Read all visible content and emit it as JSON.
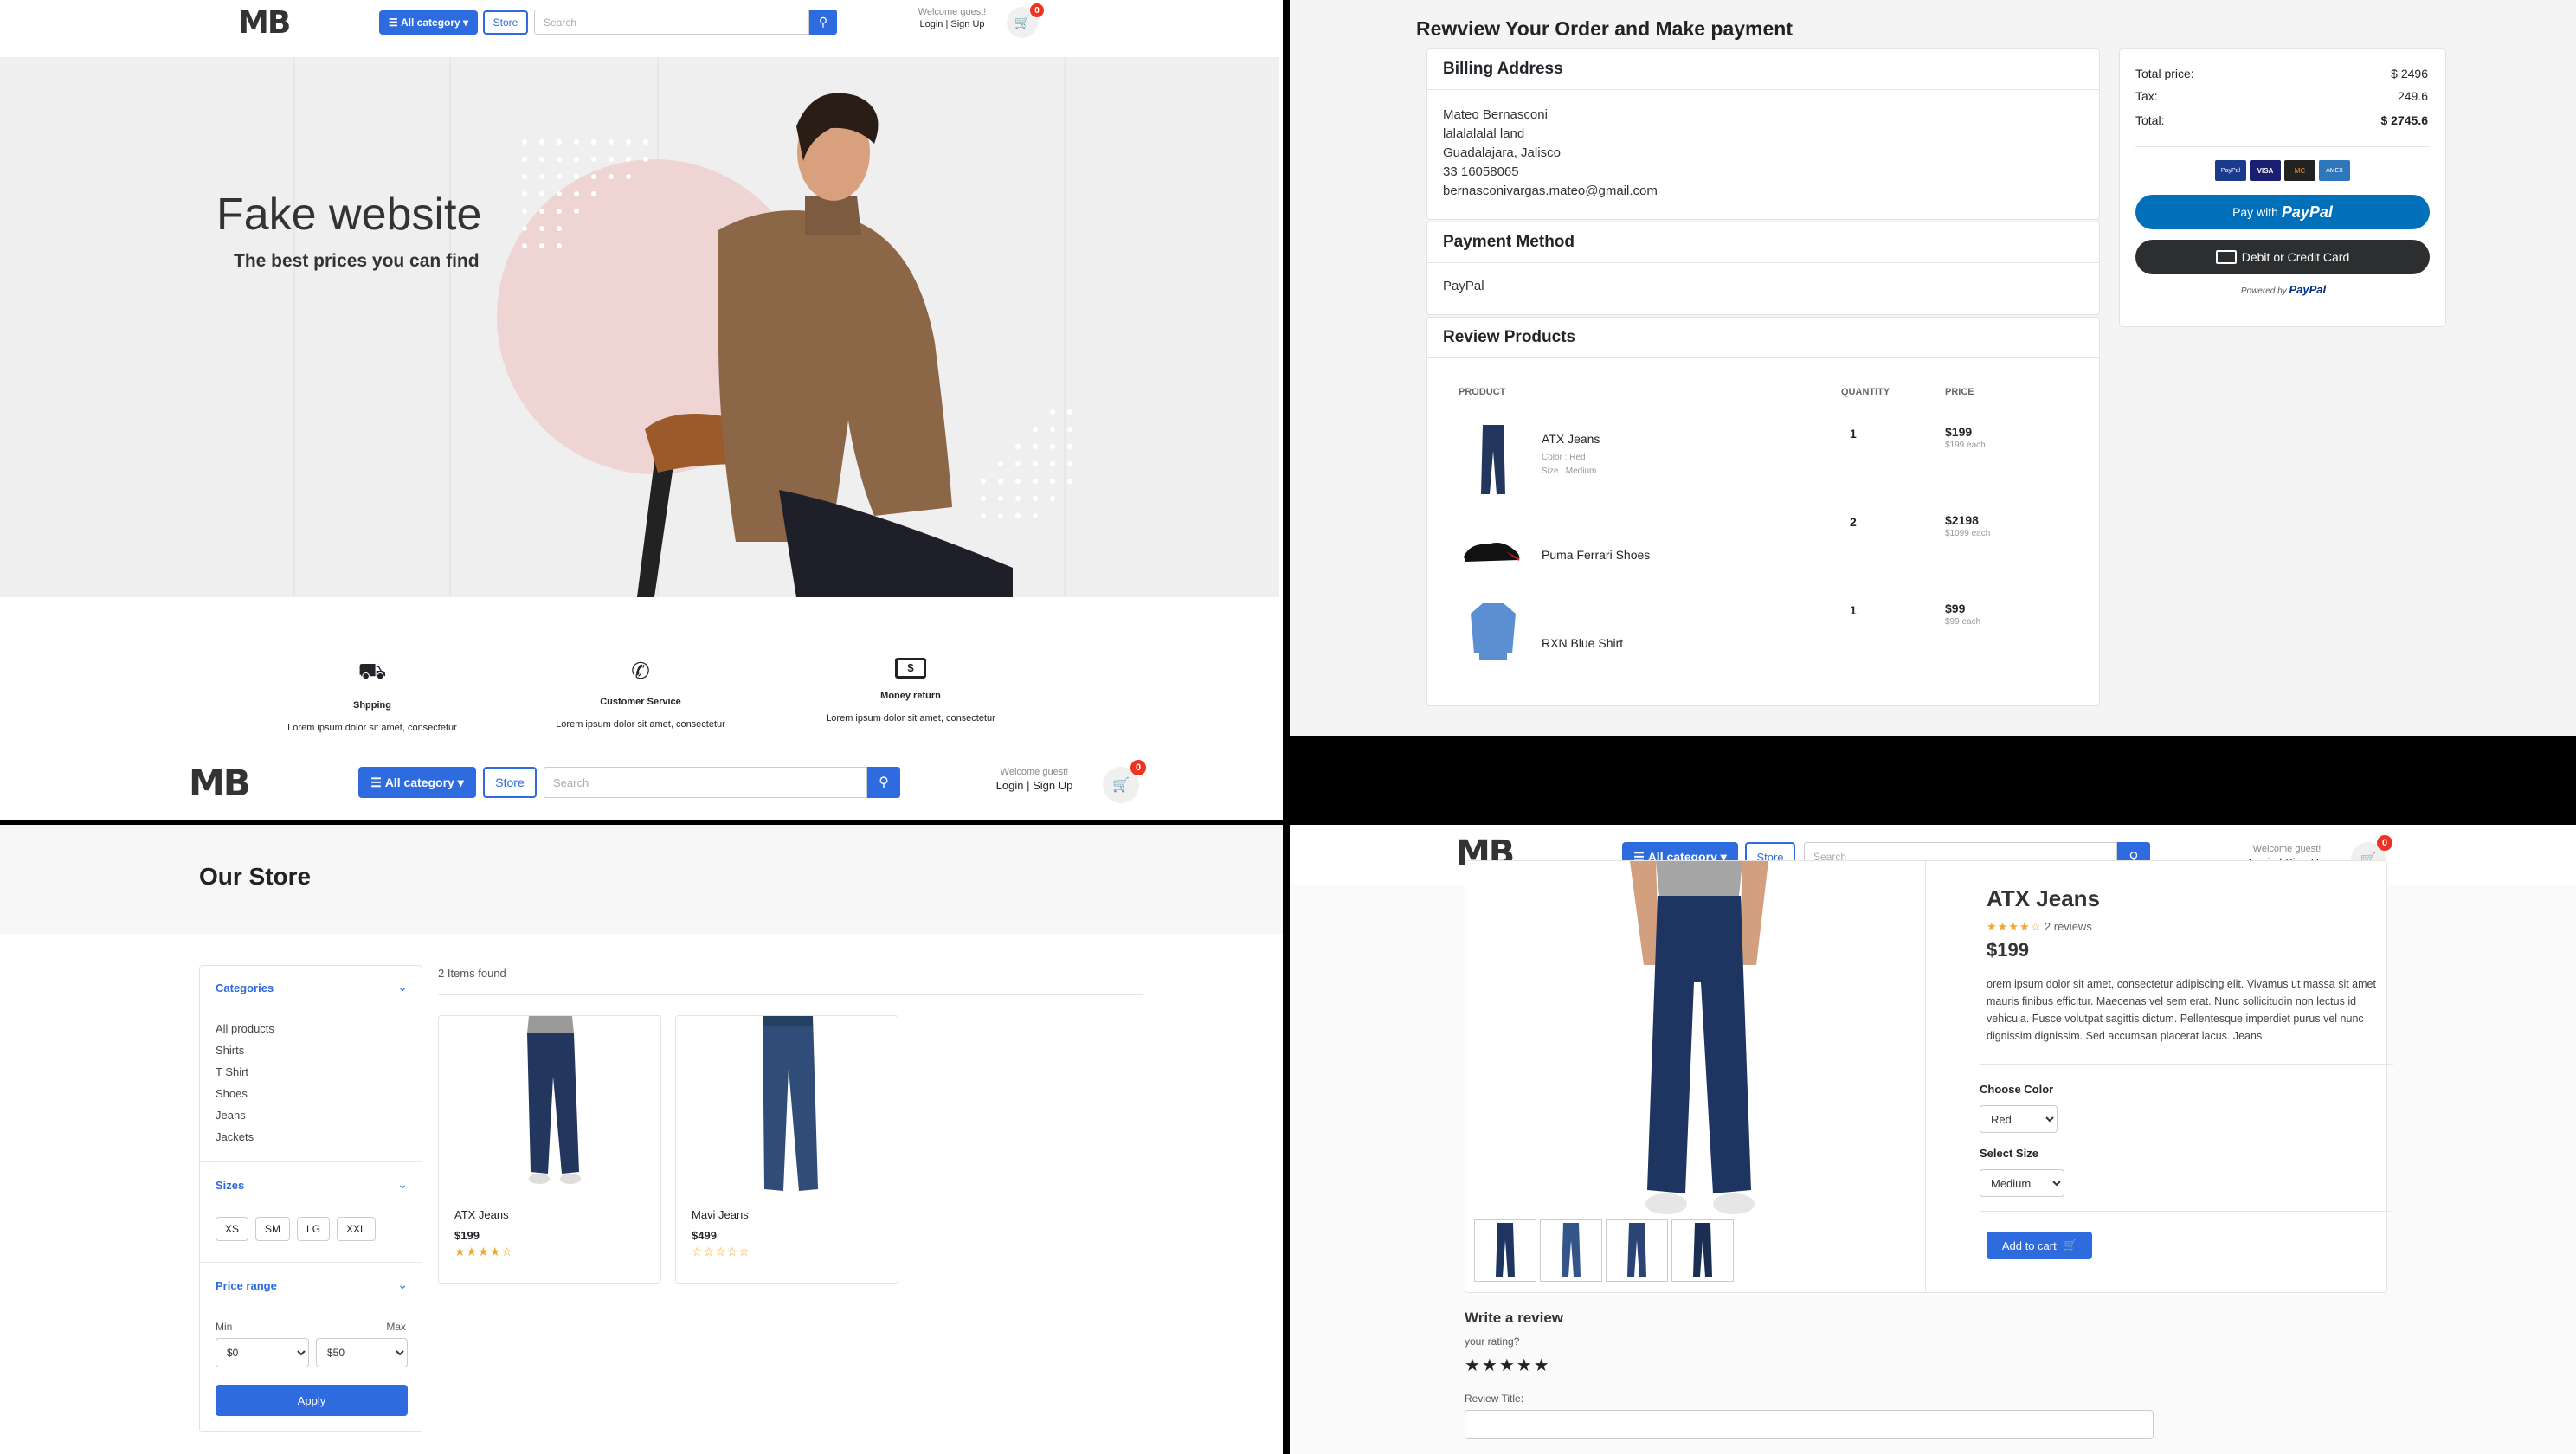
{
  "brand": {
    "logo": "MB"
  },
  "header": {
    "all_category": "All category",
    "store": "Store",
    "search_placeholder": "Search",
    "welcome": "Welcome guest!",
    "login": "Login",
    "signup": "Sign Up",
    "separator": "|",
    "cart_count": "0"
  },
  "home": {
    "hero_title": "Fake website",
    "hero_subtitle": "The best prices you can find",
    "features": [
      {
        "icon": "truck-icon",
        "title": "Shpping",
        "text": "Lorem ipsum dolor sit amet, consectetur"
      },
      {
        "icon": "phone-icon",
        "title": "Customer Service",
        "text": "Lorem ipsum dolor sit amet, consectetur"
      },
      {
        "icon": "money-icon",
        "title": "Money return",
        "text": "Lorem ipsum dolor sit amet, consectetur"
      }
    ]
  },
  "checkout": {
    "title": "Rewview Your Order and Make payment",
    "billing_title": "Billing Address",
    "billing": [
      "Mateo Bernasconi",
      "lalalalalal land",
      "Guadalajara, Jalisco",
      "33 16058065",
      "bernasconivargas.mateo@gmail.com"
    ],
    "payment_title": "Payment Method",
    "payment_method": "PayPal",
    "review_title": "Review Products",
    "col_product": "PRODUCT",
    "col_quantity": "QUANTITY",
    "col_price": "PRICE",
    "products": [
      {
        "name": "ATX Jeans",
        "color": "Color : Red",
        "size": "Size : Medium",
        "qty": "1",
        "price": "$199",
        "each": "$199 each"
      },
      {
        "name": "Puma Ferrari Shoes",
        "color": "",
        "size": "",
        "qty": "2",
        "price": "$2198",
        "each": "$1099 each"
      },
      {
        "name": "RXN Blue Shirt",
        "color": "",
        "size": "",
        "qty": "1",
        "price": "$99",
        "each": "$99 each"
      }
    ],
    "summary": {
      "total_price_label": "Total price:",
      "total_price": "$ 2496",
      "tax_label": "Tax:",
      "tax": "249.6",
      "total_label": "Total:",
      "total": "$ 2745.6"
    },
    "cards": [
      "PayPal",
      "VISA",
      "MC",
      "AMEX"
    ],
    "pay_with": "Pay with",
    "paypal": "PayPal",
    "debit_credit": "Debit or Credit Card",
    "powered_by": "Powered by"
  },
  "store": {
    "title": "Our Store",
    "items_found": "2 Items found",
    "categories_title": "Categories",
    "categories": [
      "All products",
      "Shirts",
      "T Shirt",
      "Shoes",
      "Jeans",
      "Jackets"
    ],
    "sizes_title": "Sizes",
    "sizes": [
      "XS",
      "SM",
      "LG",
      "XXL"
    ],
    "price_title": "Price range",
    "min_label": "Min",
    "max_label": "Max",
    "min_value": "$0",
    "max_value": "$50",
    "apply": "Apply",
    "products": [
      {
        "name": "ATX Jeans",
        "price": "$199",
        "stars": "★★★★☆"
      },
      {
        "name": "Mavi Jeans",
        "price": "$499",
        "stars": "☆☆☆☆☆"
      }
    ]
  },
  "product": {
    "name": "ATX Jeans",
    "stars": "★★★★☆",
    "reviews": "2 reviews",
    "price": "$199",
    "description": "orem ipsum dolor sit amet, consectetur adipiscing elit. Vivamus ut massa sit amet mauris finibus efficitur. Maecenas vel sem erat. Nunc sollicitudin non lectus id vehicula. Fusce volutpat sagittis dictum. Pellentesque imperdiet purus vel nunc dignissim dignissim. Sed accumsan placerat lacus. Jeans",
    "color_label": "Choose Color",
    "color_value": "Red",
    "size_label": "Select Size",
    "size_value": "Medium",
    "add_to_cart": "Add to cart",
    "write_review": "Write a review",
    "your_rating": "your rating?",
    "rating_stars": "★★★★★",
    "review_title_label": "Review Title:"
  },
  "colors": {
    "accent": "#2d6bdf",
    "badge": "#e32222",
    "paypal_blue": "#0070ba",
    "star": "#f5a623"
  }
}
